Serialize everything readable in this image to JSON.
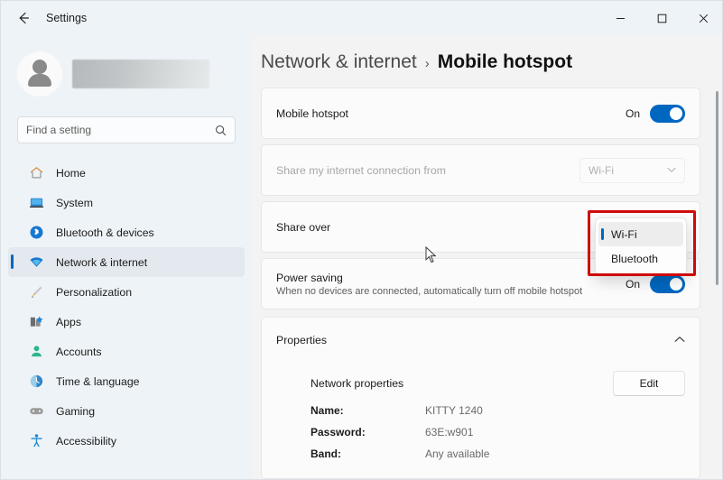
{
  "titlebar": {
    "back_icon": "back-arrow-icon",
    "title": "Settings",
    "minimize": "—",
    "maximize": "□",
    "close": "✕"
  },
  "sidebar": {
    "account_name_blurred": "",
    "search": {
      "placeholder": "Find a setting",
      "value": "",
      "icon": "search-icon"
    },
    "items": [
      {
        "label": "Home",
        "icon": "home-icon",
        "selected": false
      },
      {
        "label": "System",
        "icon": "system-icon",
        "selected": false
      },
      {
        "label": "Bluetooth & devices",
        "icon": "bluetooth-icon",
        "selected": false
      },
      {
        "label": "Network & internet",
        "icon": "wifi-icon",
        "selected": true
      },
      {
        "label": "Personalization",
        "icon": "brush-icon",
        "selected": false
      },
      {
        "label": "Apps",
        "icon": "apps-icon",
        "selected": false
      },
      {
        "label": "Accounts",
        "icon": "accounts-icon",
        "selected": false
      },
      {
        "label": "Time & language",
        "icon": "clock-icon",
        "selected": false
      },
      {
        "label": "Gaming",
        "icon": "gamepad-icon",
        "selected": false
      },
      {
        "label": "Accessibility",
        "icon": "accessibility-icon",
        "selected": false
      }
    ]
  },
  "breadcrumb": {
    "parent": "Network & internet",
    "separator": "›",
    "current": "Mobile hotspot"
  },
  "main": {
    "hotspot_row": {
      "title": "Mobile hotspot",
      "toggle_label": "On"
    },
    "share_from_row": {
      "title": "Share my internet connection from",
      "combo_value": "Wi-Fi",
      "chevron": "⌄",
      "disabled": true
    },
    "share_over_row": {
      "title": "Share over"
    },
    "power_saving_row": {
      "title": "Power saving",
      "subtitle": "When no devices are connected, automatically turn off mobile hotspot",
      "toggle_label": "On"
    },
    "properties": {
      "title": "Properties",
      "chevron": "⌃",
      "network_properties_label": "Network properties",
      "edit_button": "Edit",
      "fields": [
        {
          "key": "Name:",
          "value": "KITTY 1240"
        },
        {
          "key": "Password:",
          "value": "63E:w901"
        },
        {
          "key": "Band:",
          "value": "Any available"
        }
      ]
    }
  },
  "share_over_dropdown": {
    "options": [
      {
        "label": "Wi-Fi",
        "selected": true
      },
      {
        "label": "Bluetooth",
        "selected": false
      }
    ],
    "highlight_color": "#cf0a0a"
  },
  "colors": {
    "accent": "#0067c0",
    "annotation": "#cf0a0a",
    "window_bg": "#f3f3f3",
    "sidebar_bg": "#eef3f7"
  }
}
